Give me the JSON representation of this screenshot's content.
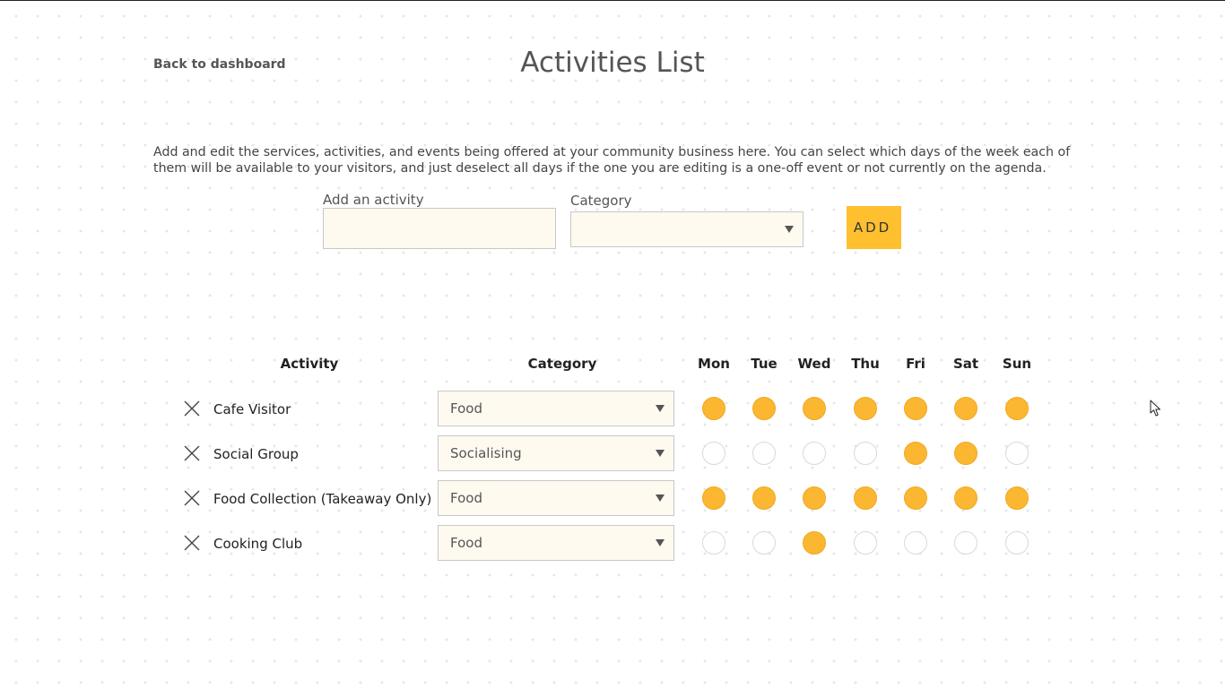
{
  "header": {
    "back_link": "Back to dashboard",
    "title": "Activities List"
  },
  "intro": "Add and edit the services, activities, and events being offered at your community business here. You can select which days of the week each of them will be available to your visitors, and just deselect all days if the one you are editing is a one-off event or not currently on the agenda.",
  "add_form": {
    "activity_label": "Add an activity",
    "activity_value": "",
    "category_label": "Category",
    "category_value": "",
    "add_button": "ADD"
  },
  "table": {
    "headers": {
      "activity": "Activity",
      "category": "Category",
      "days": [
        "Mon",
        "Tue",
        "Wed",
        "Thu",
        "Fri",
        "Sat",
        "Sun"
      ]
    },
    "rows": [
      {
        "name": "Cafe Visitor",
        "category": "Food",
        "days": [
          true,
          true,
          true,
          true,
          true,
          true,
          true
        ]
      },
      {
        "name": "Social Group",
        "category": "Socialising",
        "days": [
          false,
          false,
          false,
          false,
          true,
          true,
          false
        ]
      },
      {
        "name": "Food Collection (Takeaway Only)",
        "category": "Food",
        "days": [
          true,
          true,
          true,
          true,
          true,
          true,
          true
        ]
      },
      {
        "name": "Cooking Club",
        "category": "Food",
        "days": [
          false,
          false,
          true,
          false,
          false,
          false,
          false
        ]
      }
    ]
  },
  "colors": {
    "accent": "#fec02f",
    "day_selected": "#fbb731",
    "input_background": "#fffaf0"
  },
  "icons": {
    "remove": "close-icon",
    "dropdown": "chevron-down-icon",
    "pointer": "mouse-cursor-icon"
  }
}
